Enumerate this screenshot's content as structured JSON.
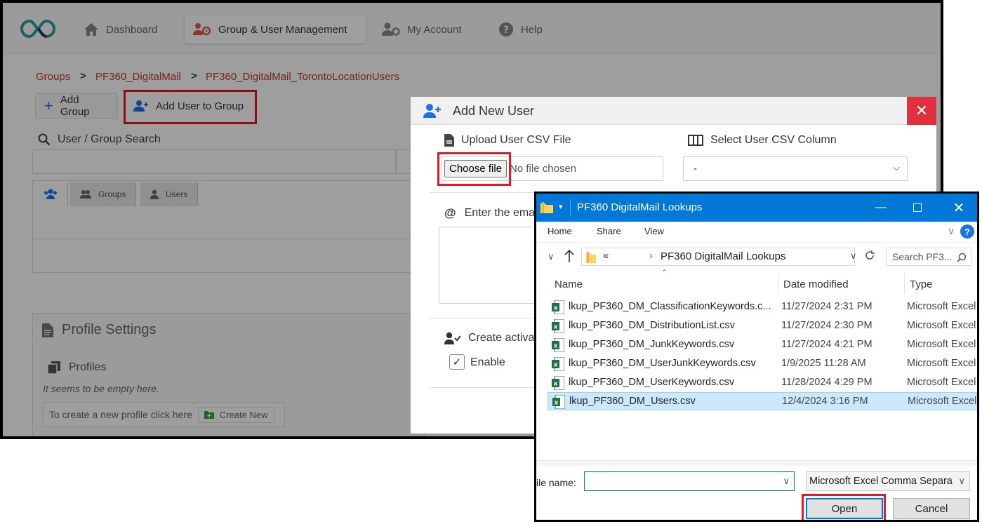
{
  "nav": {
    "dashboard": "Dashboard",
    "group_user_management": "Group & User Management",
    "my_account": "My Account",
    "help": "Help"
  },
  "breadcrumb": [
    "Groups",
    "PF360_DigitalMail",
    "PF360_DigitalMail_TorontoLocationUsers"
  ],
  "toolbar": {
    "add_group": "Add Group",
    "add_user_to_group": "Add User to Group"
  },
  "search": {
    "label": "User / Group Search"
  },
  "tabs": {
    "groups": "Groups",
    "users": "Users"
  },
  "profile": {
    "title": "Profile Settings",
    "profiles_label": "Profiles",
    "empty_text": "It seems to be empty here.",
    "create_prompt": "To create a new profile click here",
    "create_new": "Create New"
  },
  "modal": {
    "title": "Add New User",
    "close": "✕",
    "upload_label": "Upload User CSV File",
    "choose_file": "Choose file",
    "no_file": "No file chosen",
    "select_column_label": "Select User CSV Column",
    "select_value": "-",
    "email_label": "Enter the ema",
    "create_label": "Create activa",
    "enable_label": "Enable"
  },
  "dialog": {
    "title": "PF360 DigitalMail Lookups",
    "ribbon": {
      "home": "Home",
      "share": "Share",
      "view": "View"
    },
    "address": {
      "prefix": "«",
      "folder": "PF360 DigitalMail Lookups"
    },
    "search_placeholder": "Search PF3...",
    "columns": {
      "name": "Name",
      "date": "Date modified",
      "type": "Type"
    },
    "files": [
      {
        "name": "lkup_PF360_DM_ClassificationKeywords.c...",
        "date": "11/27/2024 2:31 PM",
        "type": "Microsoft Excel"
      },
      {
        "name": "lkup_PF360_DM_DistributionList.csv",
        "date": "11/27/2024 2:30 PM",
        "type": "Microsoft Excel"
      },
      {
        "name": "lkup_PF360_DM_JunkKeywords.csv",
        "date": "11/27/2024 4:21 PM",
        "type": "Microsoft Excel"
      },
      {
        "name": "lkup_PF360_DM_UserJunkKeywords.csv",
        "date": "1/9/2025 11:28 AM",
        "type": "Microsoft Excel"
      },
      {
        "name": "lkup_PF360_DM_UserKeywords.csv",
        "date": "11/28/2024 4:29 PM",
        "type": "Microsoft Excel"
      },
      {
        "name": "lkup_PF360_DM_Users.csv",
        "date": "12/4/2024 3:16 PM",
        "type": "Microsoft Excel"
      }
    ],
    "file_name_label": "ile name:",
    "file_type": "Microsoft Excel Comma Separa",
    "open": "Open",
    "cancel": "Cancel"
  },
  "colors": {
    "accent_red": "#e01b24",
    "crumb_red": "#c0392b",
    "win_blue": "#0078d7",
    "close_red": "#e0303e",
    "selection": "#cce8ff"
  }
}
